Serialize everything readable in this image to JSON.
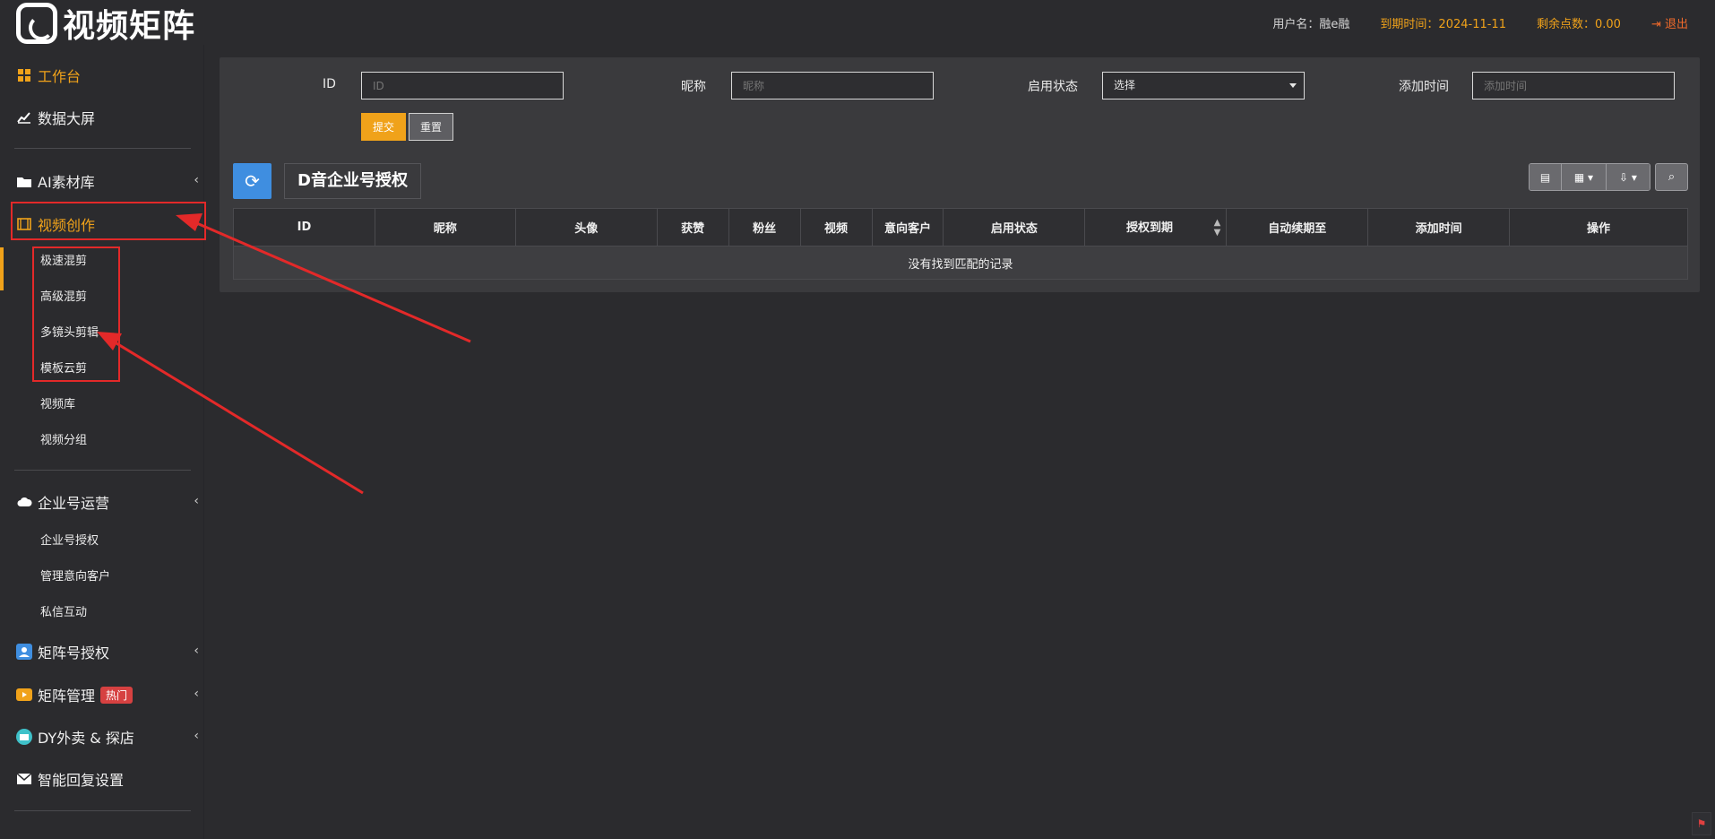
{
  "header": {
    "logo_text": "视频矩阵",
    "user": "用户名：融e融",
    "expire": "到期时间：2024-11-11",
    "points": "剩余点数：0.00",
    "logout": "退出"
  },
  "sidebar": {
    "workbench": "工作台",
    "dashboard": "数据大屏",
    "ai_library": "AI素材库",
    "video_creation": "视频创作",
    "video_sub": [
      "极速混剪",
      "高级混剪",
      "多镜头剪辑",
      "模板云剪",
      "视频库",
      "视频分组"
    ],
    "enterprise_ops": "企业号运营",
    "enterprise_sub": [
      "企业号授权",
      "管理意向客户",
      "私信互动"
    ],
    "matrix_auth": "矩阵号授权",
    "matrix_manage": "矩阵管理",
    "hot_badge": "热门",
    "dy_takeout": "DY外卖 & 探店",
    "smart_reply": "智能回复设置"
  },
  "filters": {
    "id_label": "ID",
    "id_placeholder": "ID",
    "nickname_label": "昵称",
    "nickname_placeholder": "昵称",
    "status_label": "启用状态",
    "status_value": "选择",
    "addtime_label": "添加时间",
    "addtime_placeholder": "添加时间",
    "submit": "提交",
    "reset": "重置"
  },
  "table": {
    "title": "D音企业号授权",
    "columns": [
      "ID",
      "昵称",
      "头像",
      "获赞",
      "粉丝",
      "视频",
      "意向客户",
      "启用状态",
      "授权到期",
      "自动续期至",
      "添加时间",
      "操作"
    ],
    "empty_text": "没有找到匹配的记录"
  },
  "colors": {
    "accent": "#f0a21a",
    "annotation_red": "#e32929",
    "refresh_blue": "#3f8ee0",
    "hot_red": "#d64141"
  }
}
